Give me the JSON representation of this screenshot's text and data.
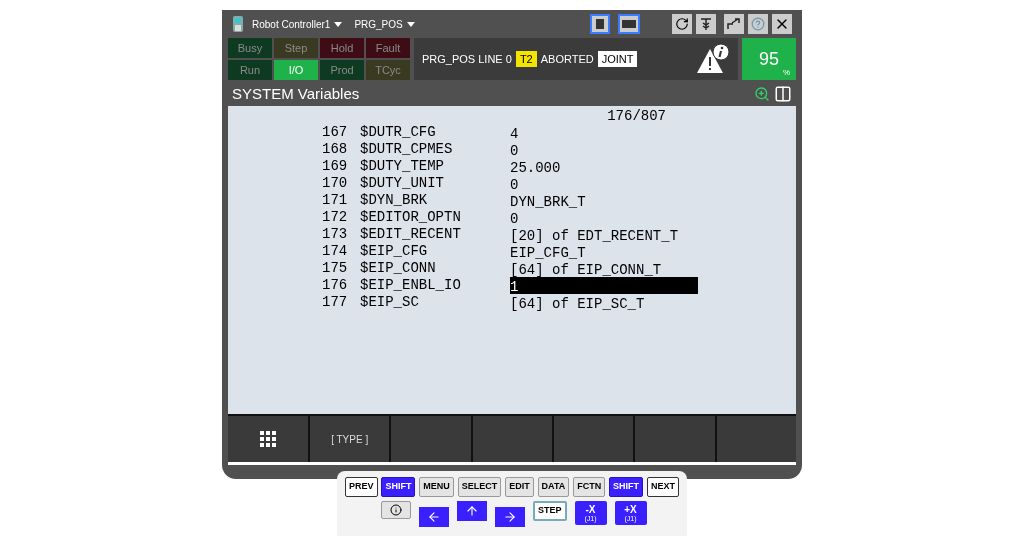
{
  "titlebar": {
    "controller": "Robot Controller1",
    "program": "PRG_POS"
  },
  "lamps": [
    {
      "label": "Busy",
      "color": "#0f3a22",
      "on": false
    },
    {
      "label": "Step",
      "color": "#3a3a22",
      "on": false
    },
    {
      "label": "Hold",
      "color": "#3d0c14",
      "on": false
    },
    {
      "label": "Fault",
      "color": "#3d0c14",
      "on": false
    },
    {
      "label": "Run",
      "color": "#0f3a22",
      "on": false
    },
    {
      "label": "I/O",
      "color": "#1fb24a",
      "on": true
    },
    {
      "label": "Prod",
      "color": "#0f3a22",
      "on": false
    },
    {
      "label": "TCyc",
      "color": "#3a3a22",
      "on": false
    }
  ],
  "status": {
    "program_line": "PRG_POS LINE 0",
    "mode": "T2",
    "state": "ABORTED",
    "coord": "JOINT"
  },
  "override": {
    "value": "95",
    "unit": "%"
  },
  "screen": {
    "title": "SYSTEM Variables",
    "position": "176/807"
  },
  "rows": [
    {
      "number": "167",
      "name": "$DUTR_CFG",
      "value": "4",
      "selected": false
    },
    {
      "number": "168",
      "name": "$DUTR_CPMES",
      "value": "0",
      "selected": false
    },
    {
      "number": "169",
      "name": "$DUTY_TEMP",
      "value": "25.000",
      "selected": false
    },
    {
      "number": "170",
      "name": "$DUTY_UNIT",
      "value": "0",
      "selected": false
    },
    {
      "number": "171",
      "name": "$DYN_BRK",
      "value": "DYN_BRK_T",
      "selected": false
    },
    {
      "number": "172",
      "name": "$EDITOR_OPTN",
      "value": "0",
      "selected": false
    },
    {
      "number": "173",
      "name": "$EDIT_RECENT",
      "value": "[20] of EDT_RECENT_T",
      "selected": false
    },
    {
      "number": "174",
      "name": "$EIP_CFG",
      "value": "EIP_CFG_T",
      "selected": false
    },
    {
      "number": "175",
      "name": "$EIP_CONN",
      "value": "[64] of EIP_CONN_T",
      "selected": false
    },
    {
      "number": "176",
      "name": "$EIP_ENBL_IO",
      "value": "1",
      "selected": true
    },
    {
      "number": "177",
      "name": "$EIP_SC",
      "value": "[64] of EIP_SC_T",
      "selected": false
    }
  ],
  "function_keys": [
    "[ TYPE ]"
  ],
  "keypad": {
    "row1": [
      {
        "label": "PREV",
        "kind": "plain"
      },
      {
        "label": "SHIFT",
        "kind": "shift"
      },
      {
        "label": "MENU",
        "kind": "grey"
      },
      {
        "label": "SELECT",
        "kind": "grey"
      },
      {
        "label": "EDIT",
        "kind": "grey"
      },
      {
        "label": "DATA",
        "kind": "grey"
      },
      {
        "label": "FCTN",
        "kind": "grey"
      },
      {
        "label": "SHIFT",
        "kind": "shift"
      },
      {
        "label": "NEXT",
        "kind": "plain"
      }
    ],
    "jog": [
      {
        "label": "-X",
        "sub": "(J1)"
      },
      {
        "label": "+X",
        "sub": "(J1)"
      }
    ],
    "step": "STEP"
  }
}
